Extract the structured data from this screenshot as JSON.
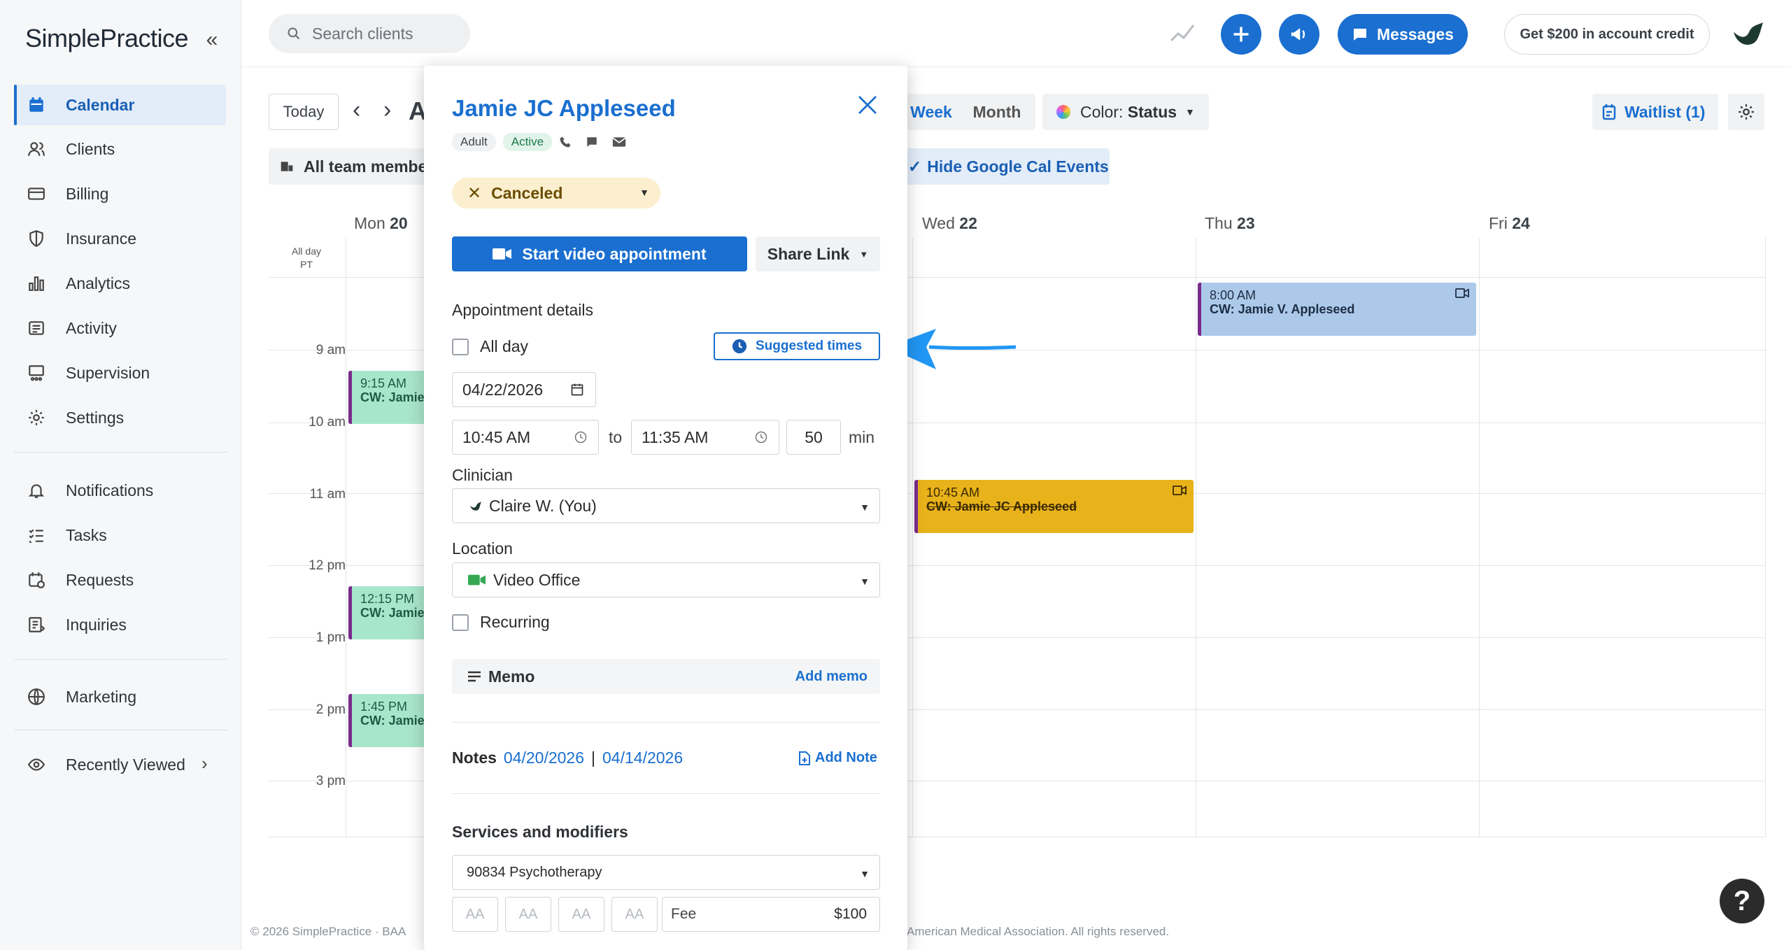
{
  "app": {
    "logo": "SimplePractice"
  },
  "sidebar": {
    "items": [
      {
        "label": "Calendar",
        "icon": "calendar-icon"
      },
      {
        "label": "Clients",
        "icon": "clients-icon"
      },
      {
        "label": "Billing",
        "icon": "billing-icon"
      },
      {
        "label": "Insurance",
        "icon": "shield-icon"
      },
      {
        "label": "Analytics",
        "icon": "bar-chart-icon"
      },
      {
        "label": "Activity",
        "icon": "activity-icon"
      },
      {
        "label": "Supervision",
        "icon": "supervision-icon"
      },
      {
        "label": "Settings",
        "icon": "gear-icon"
      },
      {
        "label": "Notifications",
        "icon": "bell-icon"
      },
      {
        "label": "Tasks",
        "icon": "tasks-icon"
      },
      {
        "label": "Requests",
        "icon": "requests-icon"
      },
      {
        "label": "Inquiries",
        "icon": "inquiries-icon"
      },
      {
        "label": "Marketing",
        "icon": "globe-icon"
      },
      {
        "label": "Recently Viewed",
        "icon": "eye-icon"
      }
    ]
  },
  "topbar": {
    "search_placeholder": "Search clients",
    "messages_label": "Messages",
    "credit_label": "Get $200 in account credit"
  },
  "toolbar": {
    "today": "Today",
    "title_partial": "A",
    "team_filter": "All team membe",
    "week": "Week",
    "month": "Month",
    "color_prefix": "Color:",
    "color_value": "Status",
    "waitlist": "Waitlist (1)",
    "hide_google": "Hide Google Cal Events"
  },
  "calendar": {
    "days": [
      {
        "name": "Mon",
        "num": "20"
      },
      {
        "name": "Wed",
        "num": "22"
      },
      {
        "name": "Thu",
        "num": "23"
      },
      {
        "name": "Fri",
        "num": "24"
      }
    ],
    "allday": "All day",
    "tz": "PT",
    "times": [
      "9 am",
      "10 am",
      "11 am",
      "12 pm",
      "1 pm",
      "2 pm",
      "3 pm"
    ],
    "events": [
      {
        "time": "9:15 AM",
        "title": "CW: Jamie"
      },
      {
        "time": "12:15 PM",
        "title": "CW: Jamie"
      },
      {
        "time": "1:45 PM",
        "title": "CW: Jamie"
      },
      {
        "time": "8:00 AM",
        "title": "CW: Jamie V. Appleseed"
      },
      {
        "time": "10:45 AM",
        "title": "CW: Jamie JC Appleseed"
      }
    ],
    "colors": {
      "green": "#a8e6cc",
      "blue": "#adc9ea",
      "gold": "#e8b21b",
      "purple": "#7a2b8c"
    }
  },
  "footer": {
    "left": "© 2026 SimplePractice · BAA",
    "right": "American Medical Association. All rights reserved."
  },
  "popup": {
    "client_name": "Jamie JC Appleseed",
    "tag_adult": "Adult",
    "tag_active": "Active",
    "status": "Canceled",
    "start_video": "Start video appointment",
    "share_link": "Share Link",
    "details_heading": "Appointment details",
    "all_day": "All day",
    "suggested": "Suggested times",
    "date": "04/22/2026",
    "start_time": "10:45 AM",
    "to": "to",
    "end_time": "11:35 AM",
    "duration": "50",
    "min": "min",
    "clinician_label": "Clinician",
    "clinician": "Claire W. (You)",
    "location_label": "Location",
    "location": "Video Office",
    "recurring": "Recurring",
    "memo": "Memo",
    "add_memo": "Add memo",
    "notes_label": "Notes",
    "note1": "04/20/2026",
    "sep": "|",
    "note2": "04/14/2026",
    "add_note": "Add Note",
    "services_label": "Services and modifiers",
    "service": "90834 Psychotherapy",
    "modifiers": [
      "AA",
      "AA",
      "AA",
      "AA"
    ],
    "fee_label": "Fee",
    "fee": "$100"
  }
}
